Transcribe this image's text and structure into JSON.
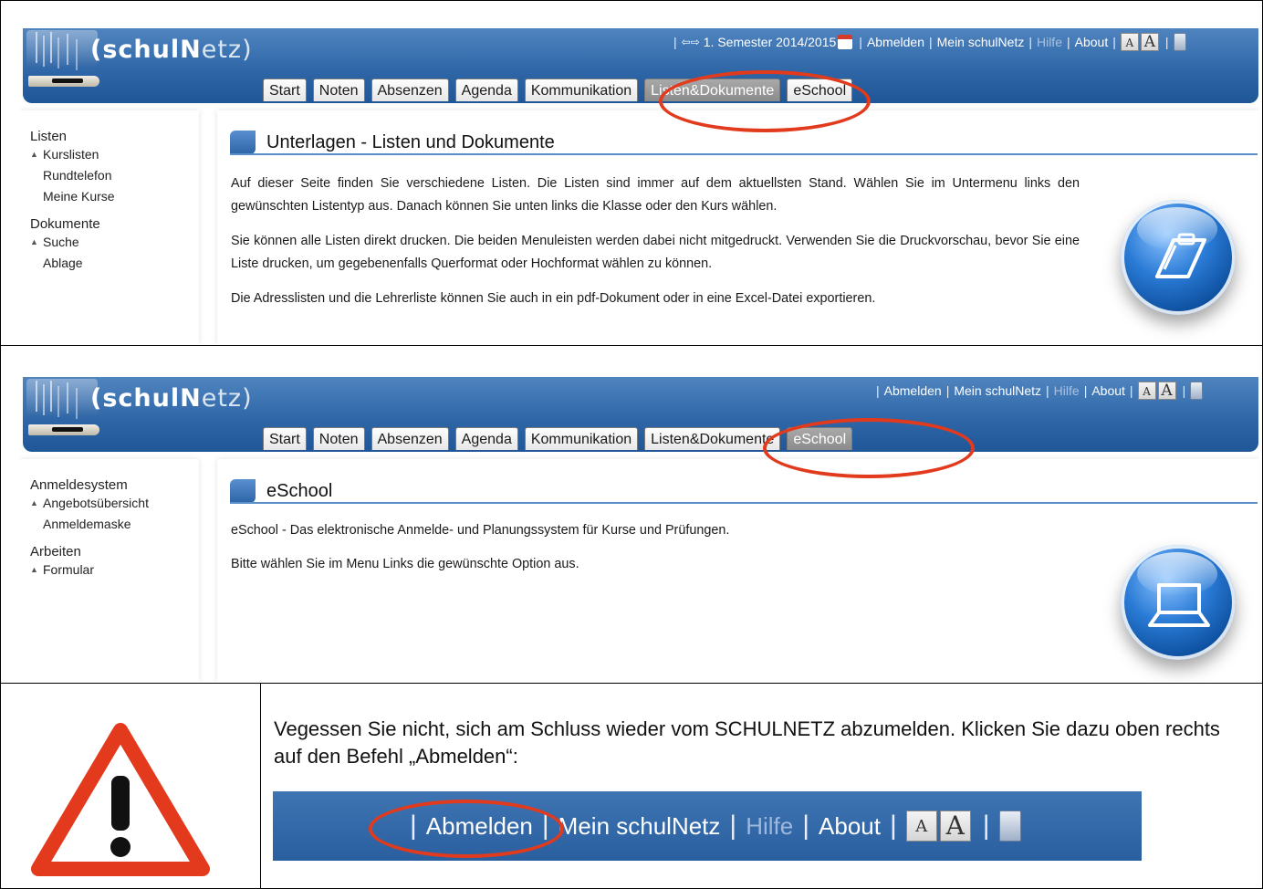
{
  "app": {
    "logo_main": "(schulN",
    "logo_tail": "etz)"
  },
  "panel1": {
    "topnav": {
      "semester": "1. Semester 2014/2015",
      "logout": "Abmelden",
      "my_schulnetz": "Mein schulNetz",
      "help": "Hilfe",
      "about": "About",
      "font_small": "A",
      "font_large": "A"
    },
    "tabs": [
      "Start",
      "Noten",
      "Absenzen",
      "Agenda",
      "Kommunikation",
      "Listen&Dokumente",
      "eSchool"
    ],
    "active_tab": "Listen&Dokumente",
    "sidebar": {
      "group1": "Listen",
      "group1_items": [
        "Kurslisten",
        "Rundtelefon",
        "Meine Kurse"
      ],
      "group2": "Dokumente",
      "group2_items": [
        "Suche",
        "Ablage"
      ]
    },
    "title": "Unterlagen - Listen und Dokumente",
    "paragraphs": [
      "Auf dieser Seite finden Sie verschiedene Listen. Die Listen sind immer auf dem aktuellsten Stand. Wählen Sie im Untermenu links den gewünschten Listentyp aus. Danach können Sie unten links die Klasse oder den Kurs wählen.",
      "Sie können alle Listen direkt drucken. Die beiden Menuleisten werden dabei nicht mitgedruckt. Verwenden Sie die Druckvorschau, bevor Sie eine Liste drucken, um gegebenenfalls Querformat oder Hochformat wählen zu können.",
      "Die Adresslisten und die Lehrerliste können Sie auch in ein pdf-Dokument oder in eine Excel-Datei exportieren."
    ]
  },
  "panel2": {
    "topnav": {
      "logout": "Abmelden",
      "my_schulnetz": "Mein schulNetz",
      "help": "Hilfe",
      "about": "About",
      "font_small": "A",
      "font_large": "A"
    },
    "tabs": [
      "Start",
      "Noten",
      "Absenzen",
      "Agenda",
      "Kommunikation",
      "Listen&Dokumente",
      "eSchool"
    ],
    "active_tab": "eSchool",
    "sidebar": {
      "group1": "Anmeldesystem",
      "group1_items": [
        "Angebotsübersicht",
        "Anmeldemaske"
      ],
      "group2": "Arbeiten",
      "group2_items": [
        "Formular"
      ]
    },
    "title": "eSchool",
    "paragraphs": [
      "eSchool - Das elektronische Anmelde- und Planungssystem für Kurse und Prüfungen.",
      "Bitte wählen Sie im Menu Links die gewünschte Option aus."
    ]
  },
  "warning": {
    "text": "Vegessen Sie nicht, sich am Schluss wieder vom SCHULNETZ abzumelden. Klicken Sie dazu oben rechts auf den Befehl „Abmelden“:",
    "strip": {
      "logout": "Abmelden",
      "my_schulnetz": "Mein schulNetz",
      "help": "Hilfe",
      "about": "About",
      "font_small": "A",
      "font_large": "A"
    }
  },
  "colors": {
    "header_blue": "#2d65a6",
    "highlight_red": "#e23a1c",
    "active_tab": "#999999"
  }
}
